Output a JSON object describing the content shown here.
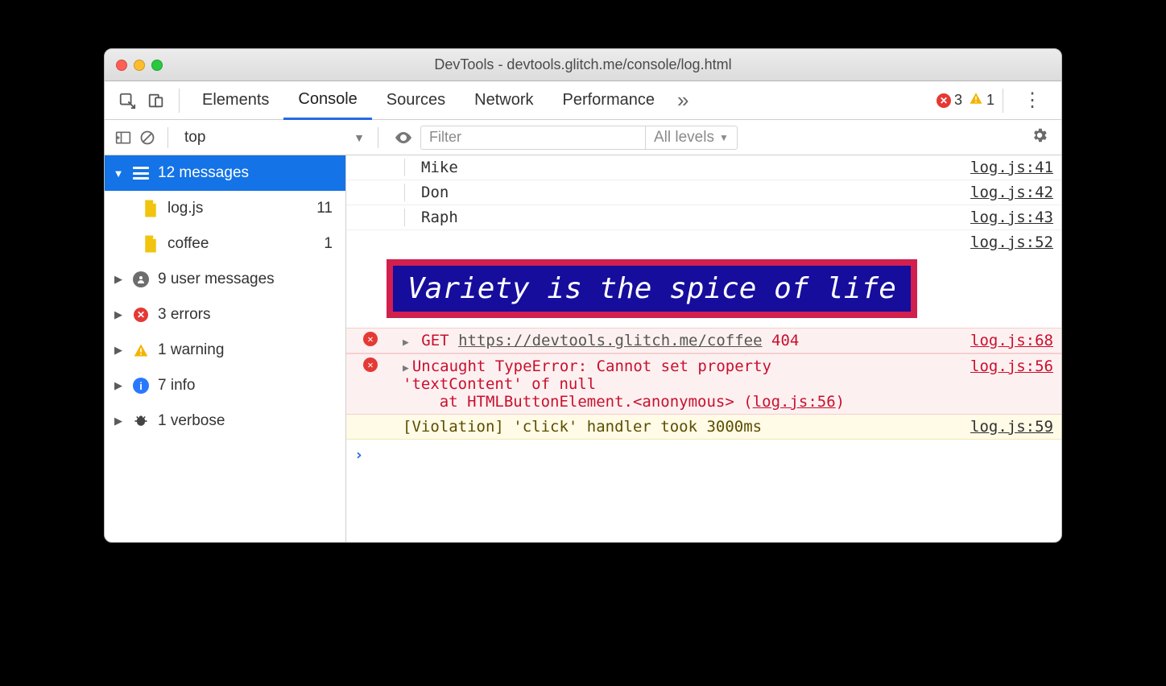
{
  "title": "DevTools - devtools.glitch.me/console/log.html",
  "tabs": {
    "elements": "Elements",
    "console": "Console",
    "sources": "Sources",
    "network": "Network",
    "performance": "Performance"
  },
  "tab_badges": {
    "errors": "3",
    "warnings": "1"
  },
  "toolbar": {
    "context": "top",
    "filter_placeholder": "Filter",
    "levels": "All levels"
  },
  "sidebar": {
    "messages": {
      "label": "12 messages"
    },
    "file1": {
      "name": "log.js",
      "count": "11"
    },
    "file2": {
      "name": "coffee",
      "count": "1"
    },
    "user": {
      "label": "9 user messages"
    },
    "errors": {
      "label": "3 errors"
    },
    "warn": {
      "label": "1 warning"
    },
    "info": {
      "label": "7 info"
    },
    "verbose": {
      "label": "1 verbose"
    }
  },
  "logs": {
    "r1": {
      "msg": "Mike",
      "src": "log.js:41"
    },
    "r2": {
      "msg": "Don",
      "src": "log.js:42"
    },
    "r3": {
      "msg": "Raph",
      "src": "log.js:43"
    },
    "r4": {
      "src": "log.js:52"
    },
    "styled": {
      "text": "Variety is the spice of life"
    },
    "err1": {
      "method": "GET",
      "url": "https://devtools.glitch.me/coffee",
      "code": "404",
      "src": "log.js:68"
    },
    "err2": {
      "line1": "Uncaught TypeError: Cannot set property",
      "line2": "'textContent' of null",
      "stack_pre": "    at HTMLButtonElement.<anonymous> (",
      "stack_link": "log.js:56",
      "stack_post": ")",
      "src": "log.js:56"
    },
    "viol": {
      "msg": "[Violation] 'click' handler took 3000ms",
      "src": "log.js:59"
    },
    "prompt": "›"
  }
}
